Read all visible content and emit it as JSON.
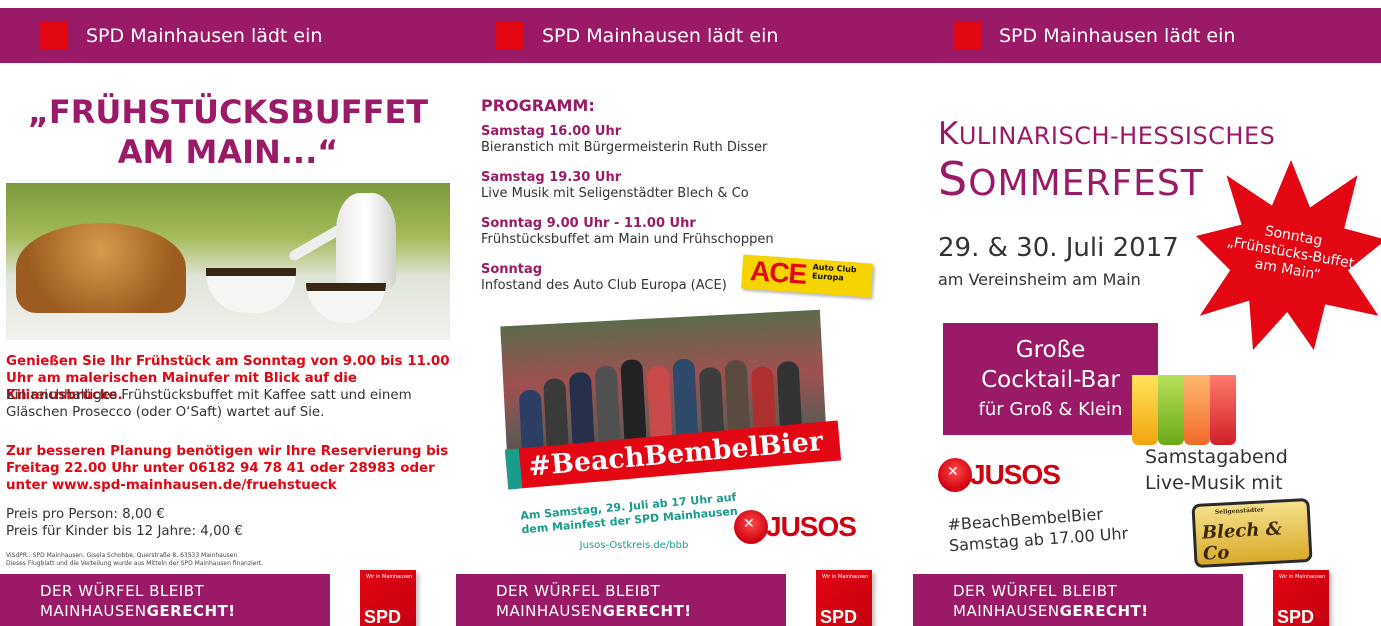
{
  "header": {
    "text": "SPD Mainhausen lädt ein"
  },
  "footer": {
    "line1": "DER WÜRFEL BLEIBT",
    "line2_normal": "MAINHAUSEN",
    "line2_bold": "GERECHT!",
    "cube_small": "Wir in Mainhausen",
    "cube_logo": "SPD"
  },
  "panel1": {
    "title_line1": "„FRÜHSTÜCKSBUFFET",
    "title_line2": "AM MAIN...“",
    "intro_red": "Genießen Sie Ihr Frühstück am Sonntag von 9.00 bis 11.00 Uhr am malerischen Mainufer mit Blick auf die Kilianusbrücke.",
    "intro_text": "Ein reichhaltiges Frühstücksbuffet mit Kaffee satt und einem Gläschen Prosecco (oder O‘Saft) wartet auf Sie.",
    "reserve": "Zur besseren Planung benötigen wir Ihre Reservierung bis Freitag 22.00 Uhr unter 06182 94 78 41 oder 28983 oder unter www.spd-mainhausen.de/fruehstueck",
    "price_adult": "Preis pro Person: 8,00 €",
    "price_kids": "Preis für Kinder bis 12 Jahre: 4,00 €",
    "visdp_1": "ViSdPR.: SPD Mainhausen, Gisela Schobbe, Querstraße 8, 63533 Mainhausen",
    "visdp_2": "Dieses Flugblatt und die Verteilung wurde aus Mitteln der SPD Mainhausen finanziert."
  },
  "panel2": {
    "program_title": "PROGRAMM:",
    "items": [
      {
        "when": "Samstag 16.00 Uhr",
        "what": "Bieranstich mit Bürgermeisterin Ruth Disser"
      },
      {
        "when": "Samstag 19.30 Uhr",
        "what": "Live Musik mit Seligenstädter Blech & Co"
      },
      {
        "when": "Sonntag 9.00 Uhr  - 11.00 Uhr",
        "what": "Frühstücksbuffet am Main und Frühschoppen"
      },
      {
        "when": "Sonntag",
        "what": "Infostand des Auto Club Europa (ACE)"
      }
    ],
    "ace_logo": "ACE",
    "ace_sub": "Auto Club Europa",
    "hashtag": "#BeachBembelBier",
    "photo_caption": "Am Samstag, 29. Juli ab 17 Uhr auf dem Mainfest der SPD Mainhausen",
    "url": "Jusos-Ostkreis.de/bbb",
    "jusos": "JUSOS"
  },
  "panel3": {
    "title_k": "K",
    "title_rest": "ULINARISCH-HESSISCHES",
    "title2_s": "S",
    "title2_rest": "OMMERFEST",
    "date": "29. & 30. Juli 2017",
    "venue": "am Vereinsheim am Main",
    "star_text": "Sonntag „Frühstücks-Buffet am Main“",
    "cocktail_1": "Große",
    "cocktail_2": "Cocktail-Bar",
    "cocktail_3": "für Groß & Klein",
    "samstagabend_1": "Samstagabend",
    "samstagabend_2": "Live-Musik mit",
    "jusos": "JUSOS",
    "beach_1": "#BeachBembelBier",
    "beach_2": "Samstag ab 17.00 Uhr",
    "blech_small": "Seligenstädter",
    "blech": "Blech & Co"
  },
  "colors": {
    "brand_purple": "#9b1a67",
    "spd_red": "#e30613",
    "teal": "#1b9b8c"
  }
}
